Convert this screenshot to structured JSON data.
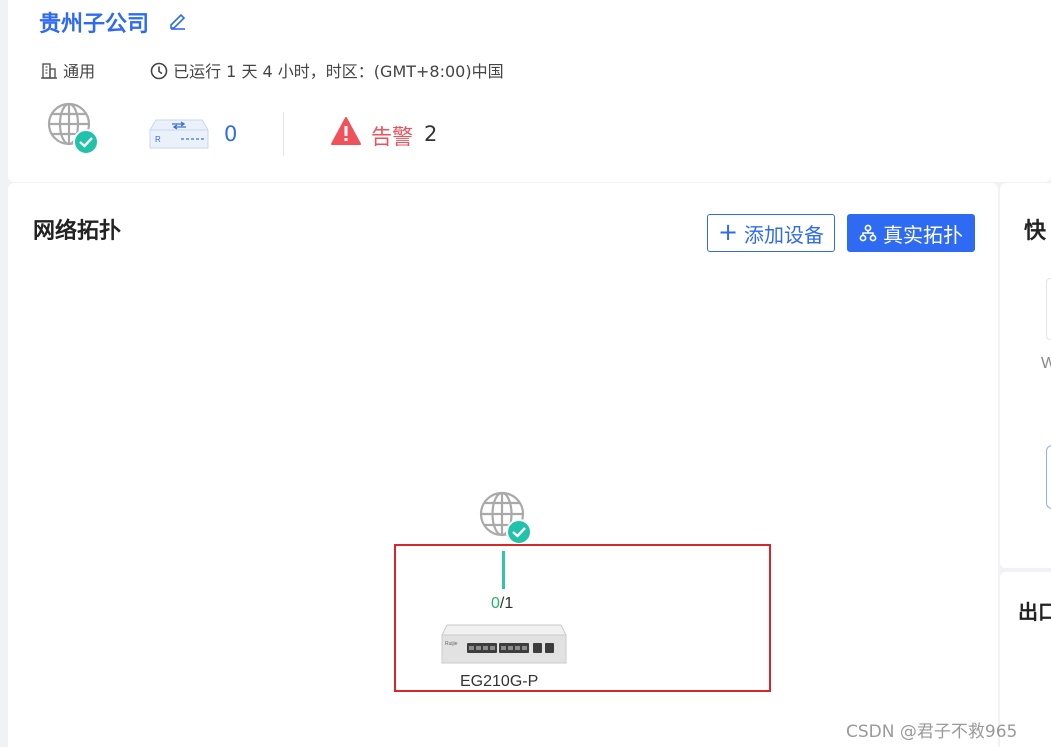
{
  "header": {
    "site_name": "贵州子公司",
    "category": "通用",
    "runtime": "已运行 1 天 4 小时，时区：(GMT+8:00)中国",
    "router_count": "0",
    "alarm_label": "告警",
    "alarm_count": "2"
  },
  "topology": {
    "title": "网络拓扑",
    "add_device_label": "添加设备",
    "real_topology_label": "真实拓扑",
    "port_up": "0",
    "port_rest": "/1",
    "device_name": "EG210G-P",
    "device_brand": "Ruijie"
  },
  "side": {
    "quick_title": "快",
    "quick_letter": "W",
    "outlet_title": "出口"
  },
  "watermark": "CSDN @君子不救965",
  "colors": {
    "accent": "#2f6bf2",
    "alarm": "#f0515a",
    "online": "#21c2aa",
    "highlight": "#d8262c"
  }
}
